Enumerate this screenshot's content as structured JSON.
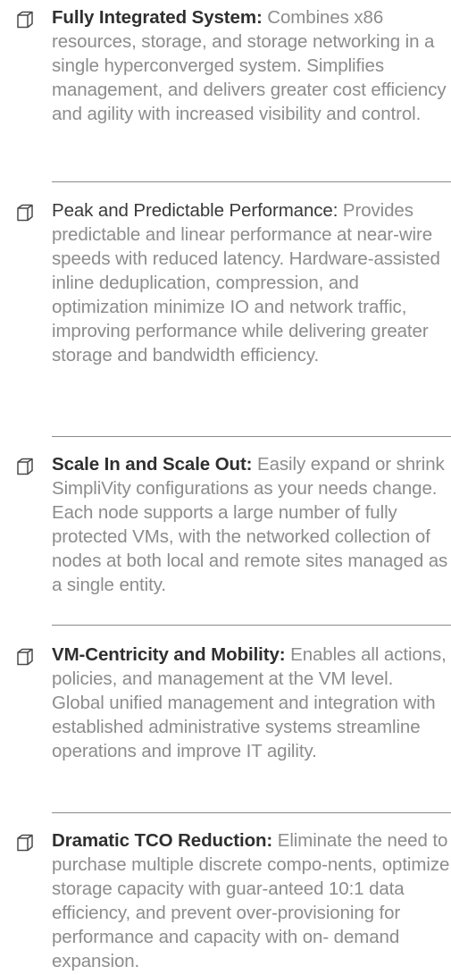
{
  "features": [
    {
      "title": "Fully Integrated System:",
      "body": "Combines x86 resources, storage, and storage networking in a single hyperconverged system. Simplifies management, and delivers greater cost efficiency and agility with increased visibility and control.",
      "icon": "cube-icon"
    },
    {
      "title": "Peak and Predictable Performance:",
      "body": "Provides predictable and linear performance at near-wire speeds with reduced latency. Hardware-assisted inline deduplication, compression, and optimization minimize IO and network traffic, improving performance while delivering greater storage and bandwidth efficiency.",
      "icon": "cube-icon"
    },
    {
      "title": "Scale In and Scale Out:",
      "body": "Easily expand or shrink SimpliVity configurations as your needs change. Each node supports a large number of fully protected VMs, with the networked collection of nodes at both local and remote sites managed as a single entity.",
      "icon": "cube-icon"
    },
    {
      "title": "VM-Centricity and Mobility:",
      "body": "Enables all actions, policies, and management at the VM level. Global unified management and integration with established administrative systems streamline operations and improve IT agility.",
      "icon": "cube-icon"
    },
    {
      "title": "Dramatic TCO Reduction:",
      "body": "Eliminate the need to purchase multiple discrete compo-nents, optimize storage capacity with guar-anteed 10:1 data efficiency, and prevent over-provisioning for performance and capacity with on- demand expansion.",
      "icon": "cube-icon"
    }
  ]
}
